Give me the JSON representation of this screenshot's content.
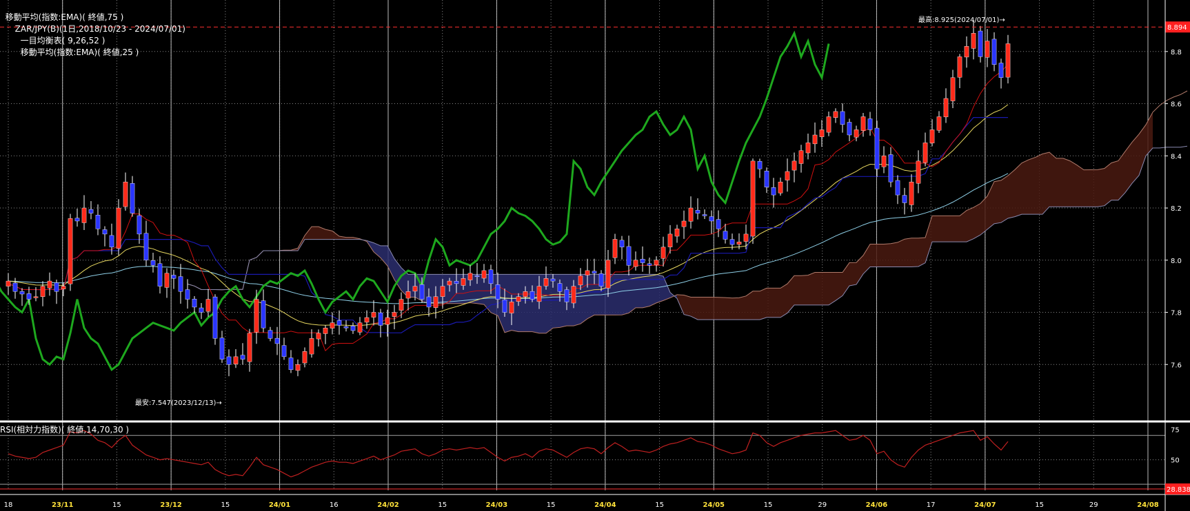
{
  "header": {
    "ema75": "移動平均(指数:EMA)( 終値,75 )",
    "symbol": "ZAR/JPY(B)(1日,2018/10/23 - 2024/07/01)",
    "ichimoku": "一目均衡表( 9,26,52 )",
    "ema25": "移動平均(指数:EMA)( 終値,25 )"
  },
  "rsi_header": "RSI(相対力指数)( 終値,14,70,30 )",
  "annotations": {
    "high": "最高:8.925(2024/07/01)→",
    "low": "最安:7.547(2023/12/13)→",
    "last_price": "8.894",
    "last_rsi": "28.838"
  },
  "colors": {
    "up": "#ff2a1a",
    "down": "#2a35ff",
    "cloud": "#4a1a10",
    "cloud_alt": "#2b2e6e",
    "chikou": "#1ea81e",
    "tenkan": "#d01010",
    "kijun": "#1a1ab0",
    "ema25": "#e8d860",
    "ema75": "#8fd0e8",
    "rsi": "#c02020",
    "grid": "#b0b0b0"
  },
  "chart_data": [
    {
      "type": "candlestick",
      "price_axis": {
        "min": 7.4,
        "max": 8.95,
        "ticks": [
          "8.8",
          "8.6",
          "8.4",
          "8.2",
          "8.0",
          "7.8",
          "7.6"
        ]
      },
      "x_labels": [
        "18",
        "23/11",
        "15",
        "23/12",
        "15",
        "24/01",
        "16",
        "24/02",
        "15",
        "24/03",
        "15",
        "24/04",
        "15",
        "24/05",
        "15",
        "29",
        "24/06",
        "17",
        "24/07",
        "15",
        "29",
        "24/08"
      ],
      "x_label_highlight": [
        false,
        true,
        false,
        true,
        false,
        true,
        false,
        true,
        false,
        true,
        false,
        true,
        false,
        true,
        false,
        false,
        true,
        false,
        true,
        false,
        false,
        true
      ],
      "closes": [
        7.92,
        7.88,
        7.87,
        7.85,
        7.86,
        7.9,
        7.92,
        7.88,
        7.9,
        8.16,
        8.15,
        8.2,
        8.18,
        8.12,
        8.1,
        8.05,
        8.2,
        8.3,
        8.18,
        8.1,
        8.0,
        7.98,
        7.9,
        7.95,
        7.93,
        7.88,
        7.85,
        7.82,
        7.8,
        7.85,
        7.7,
        7.62,
        7.6,
        7.63,
        7.62,
        7.72,
        7.85,
        7.74,
        7.7,
        7.68,
        7.63,
        7.58,
        7.6,
        7.65,
        7.7,
        7.72,
        7.74,
        7.76,
        7.75,
        7.74,
        7.73,
        7.76,
        7.78,
        7.8,
        7.75,
        7.78,
        7.8,
        7.85,
        7.88,
        7.9,
        7.85,
        7.82,
        7.86,
        7.9,
        7.92,
        7.91,
        7.93,
        7.95,
        7.94,
        7.96,
        7.91,
        7.85,
        7.8,
        7.84,
        7.86,
        7.88,
        7.85,
        7.9,
        7.93,
        7.92,
        7.88,
        7.84,
        7.9,
        7.94,
        7.96,
        7.95,
        7.9,
        8.0,
        8.08,
        8.05,
        7.98,
        8.0,
        7.99,
        7.98,
        8.0,
        8.05,
        8.1,
        8.12,
        8.15,
        8.2,
        8.18,
        8.17,
        8.15,
        8.12,
        8.08,
        8.06,
        8.07,
        8.1,
        8.38,
        8.35,
        8.28,
        8.25,
        8.3,
        8.34,
        8.38,
        8.42,
        8.45,
        8.48,
        8.5,
        8.55,
        8.57,
        8.52,
        8.48,
        8.5,
        8.55,
        8.5,
        8.35,
        8.4,
        8.3,
        8.25,
        8.22,
        8.3,
        8.38,
        8.45,
        8.5,
        8.55,
        8.62,
        8.7,
        8.78,
        8.82,
        8.87,
        8.78,
        8.84,
        8.75,
        8.7,
        8.83
      ]
    },
    {
      "type": "line",
      "title": "RSI(相対力指数)( 終値,14,70,30 )",
      "y_axis": {
        "min": 25,
        "max": 78,
        "ticks": [
          "75",
          "50"
        ]
      },
      "values": [
        55,
        53,
        52,
        51,
        52,
        56,
        58,
        60,
        62,
        73,
        72,
        74,
        71,
        66,
        64,
        60,
        66,
        70,
        62,
        58,
        54,
        52,
        50,
        51,
        50,
        49,
        48,
        47,
        46,
        48,
        42,
        39,
        37,
        38,
        37,
        44,
        52,
        46,
        44,
        42,
        39,
        36,
        38,
        41,
        44,
        46,
        48,
        49,
        48,
        48,
        47,
        49,
        51,
        53,
        50,
        52,
        54,
        57,
        58,
        59,
        55,
        53,
        55,
        58,
        59,
        58,
        59,
        60,
        59,
        60,
        56,
        52,
        49,
        52,
        53,
        55,
        52,
        57,
        59,
        58,
        55,
        52,
        56,
        59,
        60,
        59,
        55,
        60,
        64,
        61,
        57,
        58,
        57,
        56,
        58,
        61,
        63,
        64,
        66,
        68,
        65,
        64,
        62,
        59,
        57,
        55,
        56,
        58,
        72,
        70,
        64,
        61,
        64,
        66,
        68,
        70,
        71,
        72,
        72,
        73,
        74,
        70,
        66,
        67,
        70,
        66,
        55,
        57,
        50,
        46,
        44,
        52,
        58,
        62,
        64,
        66,
        68,
        70,
        72,
        73,
        74,
        66,
        69,
        63,
        58,
        65
      ]
    }
  ]
}
